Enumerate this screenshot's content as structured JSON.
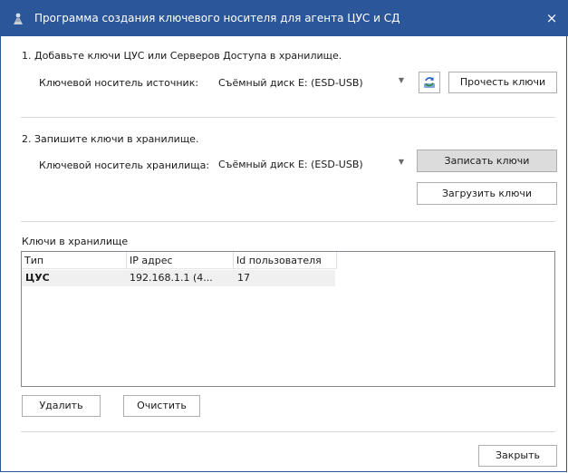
{
  "window": {
    "title": "Программа создания ключевого носителя для агента ЦУС и СД",
    "close_glyph": "×",
    "titlebar_color": "#2b579a"
  },
  "step1": {
    "heading": "1. Добавьте ключи ЦУС или Серверов Доступа в хранилище.",
    "source_label": "Ключевой носитель источник:",
    "source_value": "Съёмный диск E: (ESD-USB)",
    "read_button": "Прочесть ключи",
    "refresh_icon": "refresh-icon"
  },
  "step2": {
    "heading": "2. Запишите ключи в хранилище.",
    "storage_label": "Ключевой носитель хранилища:",
    "storage_value": "Съёмный диск E: (ESD-USB)",
    "write_button": "Записать ключи",
    "load_button": "Загрузить ключи"
  },
  "keys": {
    "heading": "Ключи в хранилище",
    "columns": [
      "Тип",
      "IP адрес",
      "Id пользователя"
    ],
    "rows": [
      [
        "ЦУС",
        "192.168.1.1 (4...",
        "17"
      ]
    ]
  },
  "actions": {
    "delete_button": "Удалить",
    "clear_button": "Очистить",
    "close_button": "Закрыть"
  }
}
